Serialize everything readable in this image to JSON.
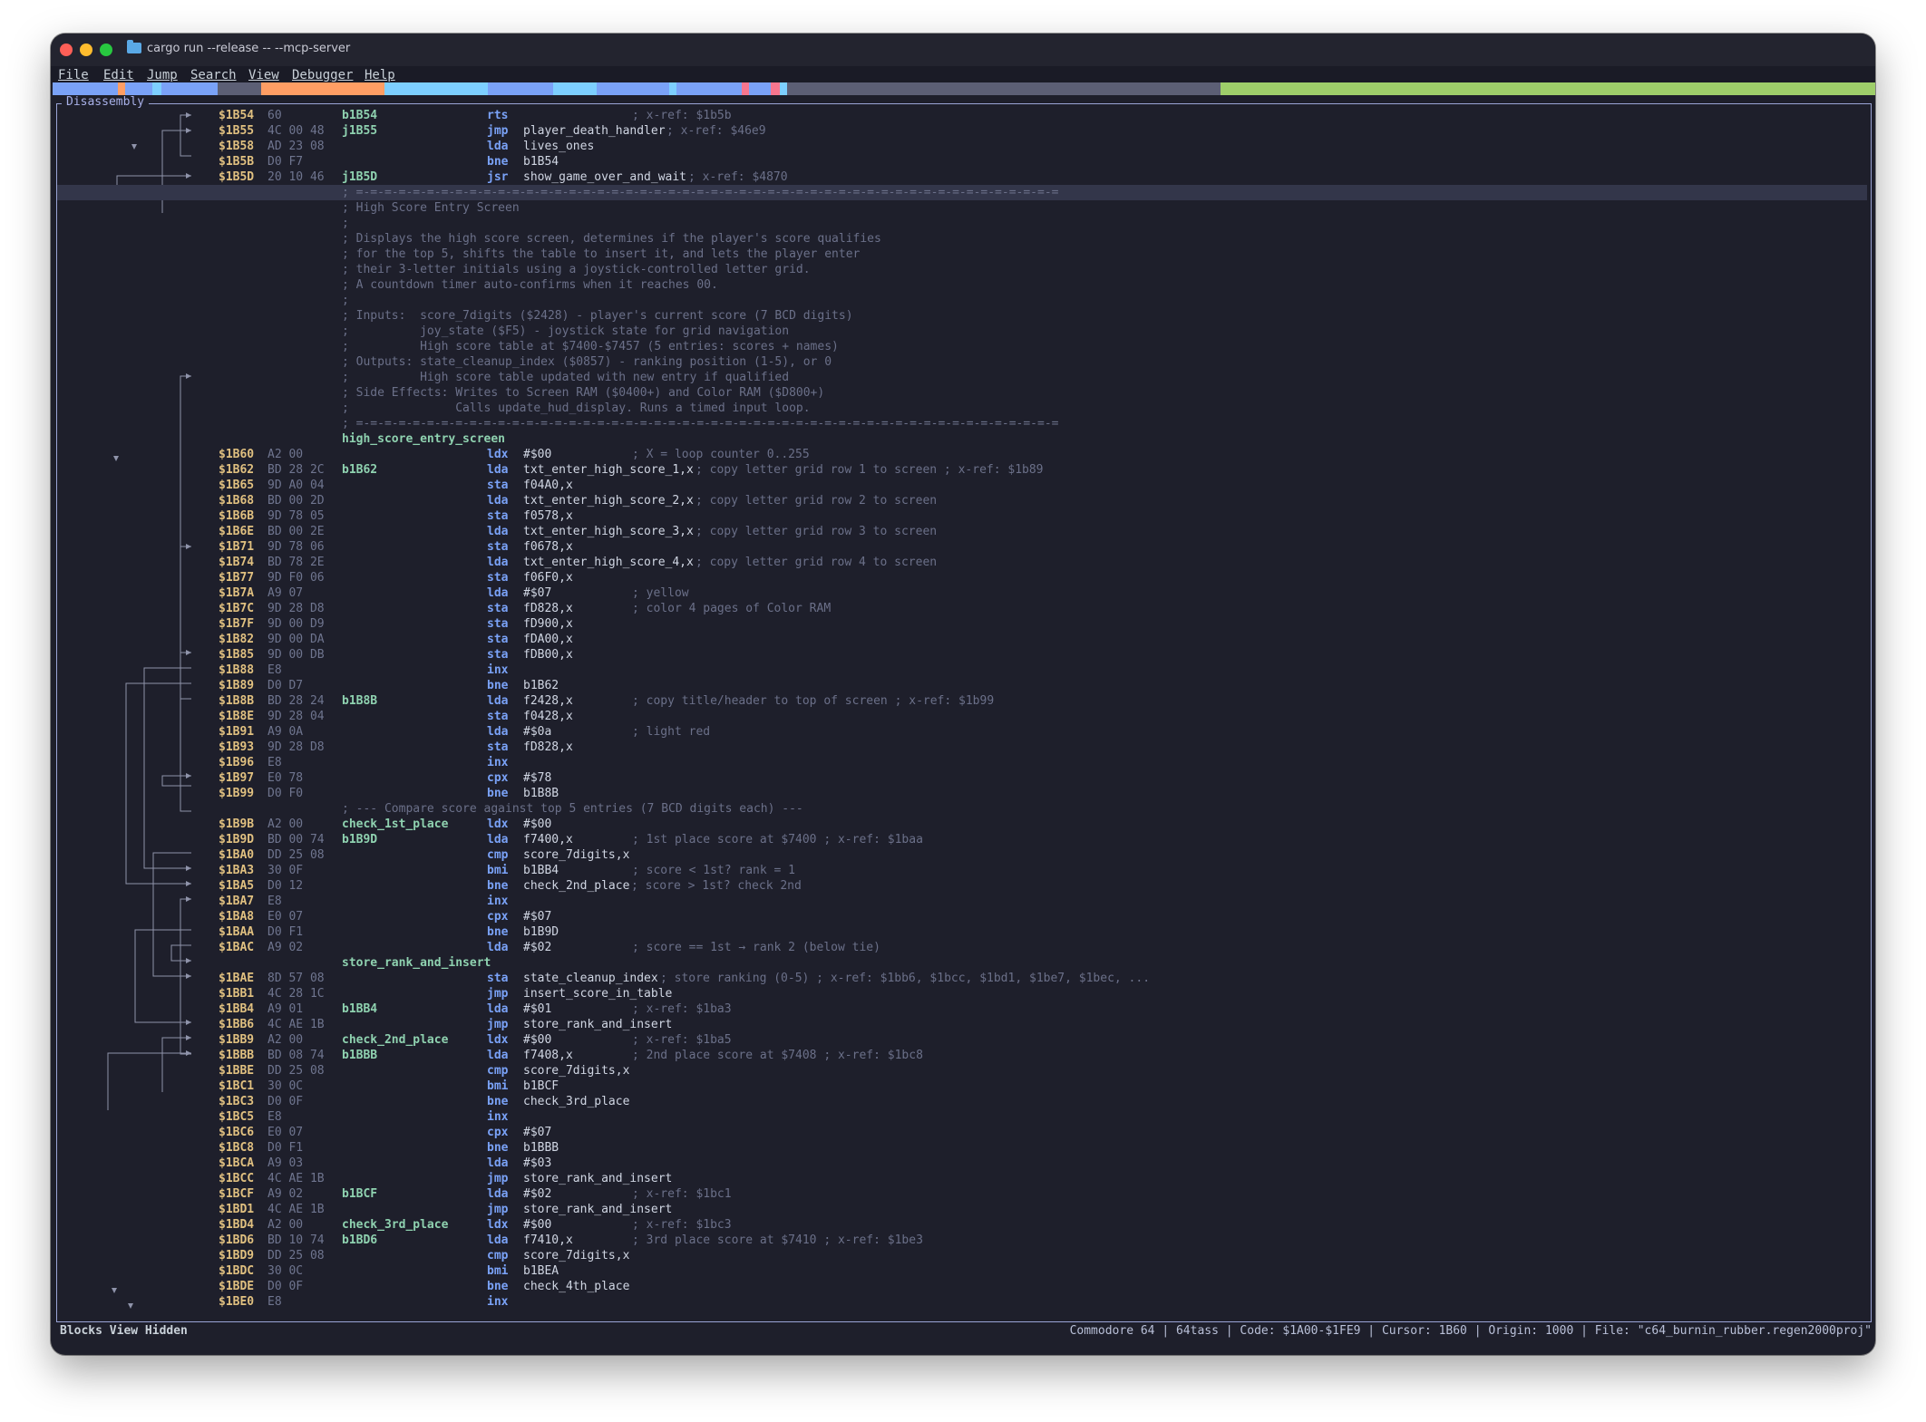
{
  "window": {
    "title": "cargo run --release -- --mcp-server"
  },
  "menu": [
    "File",
    "Edit",
    "Jump",
    "Search",
    "View",
    "Debugger",
    "Help"
  ],
  "memory_map_colors": [
    "#7aa2f7",
    "#ff9e64",
    "#7dcfff",
    "#5c5f75",
    "#9ece6a",
    "#f7768e"
  ],
  "panel": {
    "title": "Disassembly"
  },
  "status": {
    "left": "Blocks View Hidden",
    "right": "Commodore 64 | 64tass | Code: $1A00-$1FE9 | Cursor: 1B60 | Origin: 1000 | File: \"c64_burnin_rubber.regen2000proj\""
  },
  "lines": [
    {
      "addr": "$1B54",
      "bytes": "60",
      "label": "b1B54",
      "mn": "rts",
      "op": "",
      "cm": "; x-ref: $1b5b"
    },
    {
      "addr": "$1B55",
      "bytes": "4C 00 48",
      "label": "j1B55",
      "mn": "jmp",
      "op": "player_death_handler",
      "cm": "; x-ref: $46e9"
    },
    {
      "addr": "$1B58",
      "bytes": "AD 23 08",
      "label": "",
      "mn": "lda",
      "op": "lives_ones",
      "cm": ""
    },
    {
      "addr": "$1B5B",
      "bytes": "D0 F7",
      "label": "",
      "mn": "bne",
      "op": "b1B54",
      "cm": ""
    },
    {
      "addr": "$1B5D",
      "bytes": "20 10 46",
      "label": "j1B5D",
      "mn": "jsr",
      "op": "show_game_over_and_wait",
      "cm": "; x-ref: $4870"
    },
    {
      "text": "; =-=-=-=-=-=-=-=-=-=-=-=-=-=-=-=-=-=-=-=-=-=-=-=-=-=-=-=-=-=-=-=-=-=-=-=-=-=-=-=-=-=-=-=-=-=-=-=-=-="
    },
    {
      "text": "; High Score Entry Screen"
    },
    {
      "text": ";"
    },
    {
      "text": "; Displays the high score screen, determines if the player's score qualifies"
    },
    {
      "text": "; for the top 5, shifts the table to insert it, and lets the player enter"
    },
    {
      "text": "; their 3-letter initials using a joystick-controlled letter grid."
    },
    {
      "text": "; A countdown timer auto-confirms when it reaches 00."
    },
    {
      "text": ";"
    },
    {
      "text": "; Inputs:  score_7digits ($2428) - player's current score (7 BCD digits)"
    },
    {
      "text": ";          joy_state ($F5) - joystick state for grid navigation"
    },
    {
      "text": ";          High score table at $7400-$7457 (5 entries: scores + names)"
    },
    {
      "text": "; Outputs: state_cleanup_index ($0857) - ranking position (1-5), or 0"
    },
    {
      "text": ";          High score table updated with new entry if qualified"
    },
    {
      "text": "; Side Effects: Writes to Screen RAM ($0400+) and Color RAM ($D800+)"
    },
    {
      "text": ";               Calls update_hud_display. Runs a timed input loop."
    },
    {
      "text": "; =-=-=-=-=-=-=-=-=-=-=-=-=-=-=-=-=-=-=-=-=-=-=-=-=-=-=-=-=-=-=-=-=-=-=-=-=-=-=-=-=-=-=-=-=-=-=-=-=-="
    },
    {
      "labelline": "high_score_entry_screen"
    },
    {
      "addr": "$1B60",
      "bytes": "A2 00",
      "label": "",
      "mn": "ldx",
      "op": "#$00",
      "cm": "; X = loop counter 0..255"
    },
    {
      "addr": "$1B62",
      "bytes": "BD 28 2C",
      "label": "b1B62",
      "mn": "lda",
      "op": "txt_enter_high_score_1,x",
      "cm": "; copy letter grid row 1 to screen ; x-ref: $1b89"
    },
    {
      "addr": "$1B65",
      "bytes": "9D A0 04",
      "label": "",
      "mn": "sta",
      "op": "f04A0,x",
      "cm": ""
    },
    {
      "addr": "$1B68",
      "bytes": "BD 00 2D",
      "label": "",
      "mn": "lda",
      "op": "txt_enter_high_score_2,x",
      "cm": "; copy letter grid row 2 to screen"
    },
    {
      "addr": "$1B6B",
      "bytes": "9D 78 05",
      "label": "",
      "mn": "sta",
      "op": "f0578,x",
      "cm": ""
    },
    {
      "addr": "$1B6E",
      "bytes": "BD 00 2E",
      "label": "",
      "mn": "lda",
      "op": "txt_enter_high_score_3,x",
      "cm": "; copy letter grid row 3 to screen"
    },
    {
      "addr": "$1B71",
      "bytes": "9D 78 06",
      "label": "",
      "mn": "sta",
      "op": "f0678,x",
      "cm": ""
    },
    {
      "addr": "$1B74",
      "bytes": "BD 78 2E",
      "label": "",
      "mn": "lda",
      "op": "txt_enter_high_score_4,x",
      "cm": "; copy letter grid row 4 to screen"
    },
    {
      "addr": "$1B77",
      "bytes": "9D F0 06",
      "label": "",
      "mn": "sta",
      "op": "f06F0,x",
      "cm": ""
    },
    {
      "addr": "$1B7A",
      "bytes": "A9 07",
      "label": "",
      "mn": "lda",
      "op": "#$07",
      "cm": "; yellow"
    },
    {
      "addr": "$1B7C",
      "bytes": "9D 28 D8",
      "label": "",
      "mn": "sta",
      "op": "fD828,x",
      "cm": "; color 4 pages of Color RAM"
    },
    {
      "addr": "$1B7F",
      "bytes": "9D 00 D9",
      "label": "",
      "mn": "sta",
      "op": "fD900,x",
      "cm": ""
    },
    {
      "addr": "$1B82",
      "bytes": "9D 00 DA",
      "label": "",
      "mn": "sta",
      "op": "fDA00,x",
      "cm": ""
    },
    {
      "addr": "$1B85",
      "bytes": "9D 00 DB",
      "label": "",
      "mn": "sta",
      "op": "fDB00,x",
      "cm": ""
    },
    {
      "addr": "$1B88",
      "bytes": "E8",
      "label": "",
      "mn": "inx",
      "op": "",
      "cm": ""
    },
    {
      "addr": "$1B89",
      "bytes": "D0 D7",
      "label": "",
      "mn": "bne",
      "op": "b1B62",
      "cm": ""
    },
    {
      "addr": "$1B8B",
      "bytes": "BD 28 24",
      "label": "b1B8B",
      "mn": "lda",
      "op": "f2428,x",
      "cm": "; copy title/header to top of screen ; x-ref: $1b99"
    },
    {
      "addr": "$1B8E",
      "bytes": "9D 28 04",
      "label": "",
      "mn": "sta",
      "op": "f0428,x",
      "cm": ""
    },
    {
      "addr": "$1B91",
      "bytes": "A9 0A",
      "label": "",
      "mn": "lda",
      "op": "#$0a",
      "cm": "; light red"
    },
    {
      "addr": "$1B93",
      "bytes": "9D 28 D8",
      "label": "",
      "mn": "sta",
      "op": "fD828,x",
      "cm": ""
    },
    {
      "addr": "$1B96",
      "bytes": "E8",
      "label": "",
      "mn": "inx",
      "op": "",
      "cm": ""
    },
    {
      "addr": "$1B97",
      "bytes": "E0 78",
      "label": "",
      "mn": "cpx",
      "op": "#$78",
      "cm": ""
    },
    {
      "addr": "$1B99",
      "bytes": "D0 F0",
      "label": "",
      "mn": "bne",
      "op": "b1B8B",
      "cm": ""
    },
    {
      "text": "; --- Compare score against top 5 entries (7 BCD digits each) ---"
    },
    {
      "addr": "$1B9B",
      "bytes": "A2 00",
      "label": "check_1st_place",
      "mn": "ldx",
      "op": "#$00",
      "cm": ""
    },
    {
      "addr": "$1B9D",
      "bytes": "BD 00 74",
      "label": "b1B9D",
      "mn": "lda",
      "op": "f7400,x",
      "cm": "; 1st place score at $7400 ; x-ref: $1baa"
    },
    {
      "addr": "$1BA0",
      "bytes": "DD 25 08",
      "label": "",
      "mn": "cmp",
      "op": "score_7digits,x",
      "cm": ""
    },
    {
      "addr": "$1BA3",
      "bytes": "30 0F",
      "label": "",
      "mn": "bmi",
      "op": "b1BB4",
      "cm": "; score < 1st? rank = 1"
    },
    {
      "addr": "$1BA5",
      "bytes": "D0 12",
      "label": "",
      "mn": "bne",
      "op": "check_2nd_place",
      "cm": "; score > 1st? check 2nd"
    },
    {
      "addr": "$1BA7",
      "bytes": "E8",
      "label": "",
      "mn": "inx",
      "op": "",
      "cm": ""
    },
    {
      "addr": "$1BA8",
      "bytes": "E0 07",
      "label": "",
      "mn": "cpx",
      "op": "#$07",
      "cm": ""
    },
    {
      "addr": "$1BAA",
      "bytes": "D0 F1",
      "label": "",
      "mn": "bne",
      "op": "b1B9D",
      "cm": ""
    },
    {
      "addr": "$1BAC",
      "bytes": "A9 02",
      "label": "",
      "mn": "lda",
      "op": "#$02",
      "cm": "; score == 1st → rank 2 (below tie)"
    },
    {
      "labelline": "store_rank_and_insert"
    },
    {
      "addr": "$1BAE",
      "bytes": "8D 57 08",
      "label": "",
      "mn": "sta",
      "op": "state_cleanup_index",
      "cm": "; store ranking (0-5) ; x-ref: $1bb6, $1bcc, $1bd1, $1be7, $1bec, ..."
    },
    {
      "addr": "$1BB1",
      "bytes": "4C 28 1C",
      "label": "",
      "mn": "jmp",
      "op": "insert_score_in_table",
      "cm": ""
    },
    {
      "addr": "$1BB4",
      "bytes": "A9 01",
      "label": "b1BB4",
      "mn": "lda",
      "op": "#$01",
      "cm": "; x-ref: $1ba3"
    },
    {
      "addr": "$1BB6",
      "bytes": "4C AE 1B",
      "label": "",
      "mn": "jmp",
      "op": "store_rank_and_insert",
      "cm": ""
    },
    {
      "addr": "$1BB9",
      "bytes": "A2 00",
      "label": "check_2nd_place",
      "mn": "ldx",
      "op": "#$00",
      "cm": "; x-ref: $1ba5"
    },
    {
      "addr": "$1BBB",
      "bytes": "BD 08 74",
      "label": "b1BBB",
      "mn": "lda",
      "op": "f7408,x",
      "cm": "; 2nd place score at $7408 ; x-ref: $1bc8"
    },
    {
      "addr": "$1BBE",
      "bytes": "DD 25 08",
      "label": "",
      "mn": "cmp",
      "op": "score_7digits,x",
      "cm": ""
    },
    {
      "addr": "$1BC1",
      "bytes": "30 0C",
      "label": "",
      "mn": "bmi",
      "op": "b1BCF",
      "cm": ""
    },
    {
      "addr": "$1BC3",
      "bytes": "D0 0F",
      "label": "",
      "mn": "bne",
      "op": "check_3rd_place",
      "cm": ""
    },
    {
      "addr": "$1BC5",
      "bytes": "E8",
      "label": "",
      "mn": "inx",
      "op": "",
      "cm": ""
    },
    {
      "addr": "$1BC6",
      "bytes": "E0 07",
      "label": "",
      "mn": "cpx",
      "op": "#$07",
      "cm": ""
    },
    {
      "addr": "$1BC8",
      "bytes": "D0 F1",
      "label": "",
      "mn": "bne",
      "op": "b1BBB",
      "cm": ""
    },
    {
      "addr": "$1BCA",
      "bytes": "A9 03",
      "label": "",
      "mn": "lda",
      "op": "#$03",
      "cm": ""
    },
    {
      "addr": "$1BCC",
      "bytes": "4C AE 1B",
      "label": "",
      "mn": "jmp",
      "op": "store_rank_and_insert",
      "cm": ""
    },
    {
      "addr": "$1BCF",
      "bytes": "A9 02",
      "label": "b1BCF",
      "mn": "lda",
      "op": "#$02",
      "cm": "; x-ref: $1bc1"
    },
    {
      "addr": "$1BD1",
      "bytes": "4C AE 1B",
      "label": "",
      "mn": "jmp",
      "op": "store_rank_and_insert",
      "cm": ""
    },
    {
      "addr": "$1BD4",
      "bytes": "A2 00",
      "label": "check_3rd_place",
      "mn": "ldx",
      "op": "#$00",
      "cm": "; x-ref: $1bc3"
    },
    {
      "addr": "$1BD6",
      "bytes": "BD 10 74",
      "label": "b1BD6",
      "mn": "lda",
      "op": "f7410,x",
      "cm": "; 3rd place score at $7410 ; x-ref: $1be3"
    },
    {
      "addr": "$1BD9",
      "bytes": "DD 25 08",
      "label": "",
      "mn": "cmp",
      "op": "score_7digits,x",
      "cm": ""
    },
    {
      "addr": "$1BDC",
      "bytes": "30 0C",
      "label": "",
      "mn": "bmi",
      "op": "b1BEA",
      "cm": ""
    },
    {
      "addr": "$1BDE",
      "bytes": "D0 0F",
      "label": "",
      "mn": "bne",
      "op": "check_4th_place",
      "cm": ""
    },
    {
      "addr": "$1BE0",
      "bytes": "E8",
      "label": "",
      "mn": "inx",
      "op": "",
      "cm": ""
    }
  ]
}
